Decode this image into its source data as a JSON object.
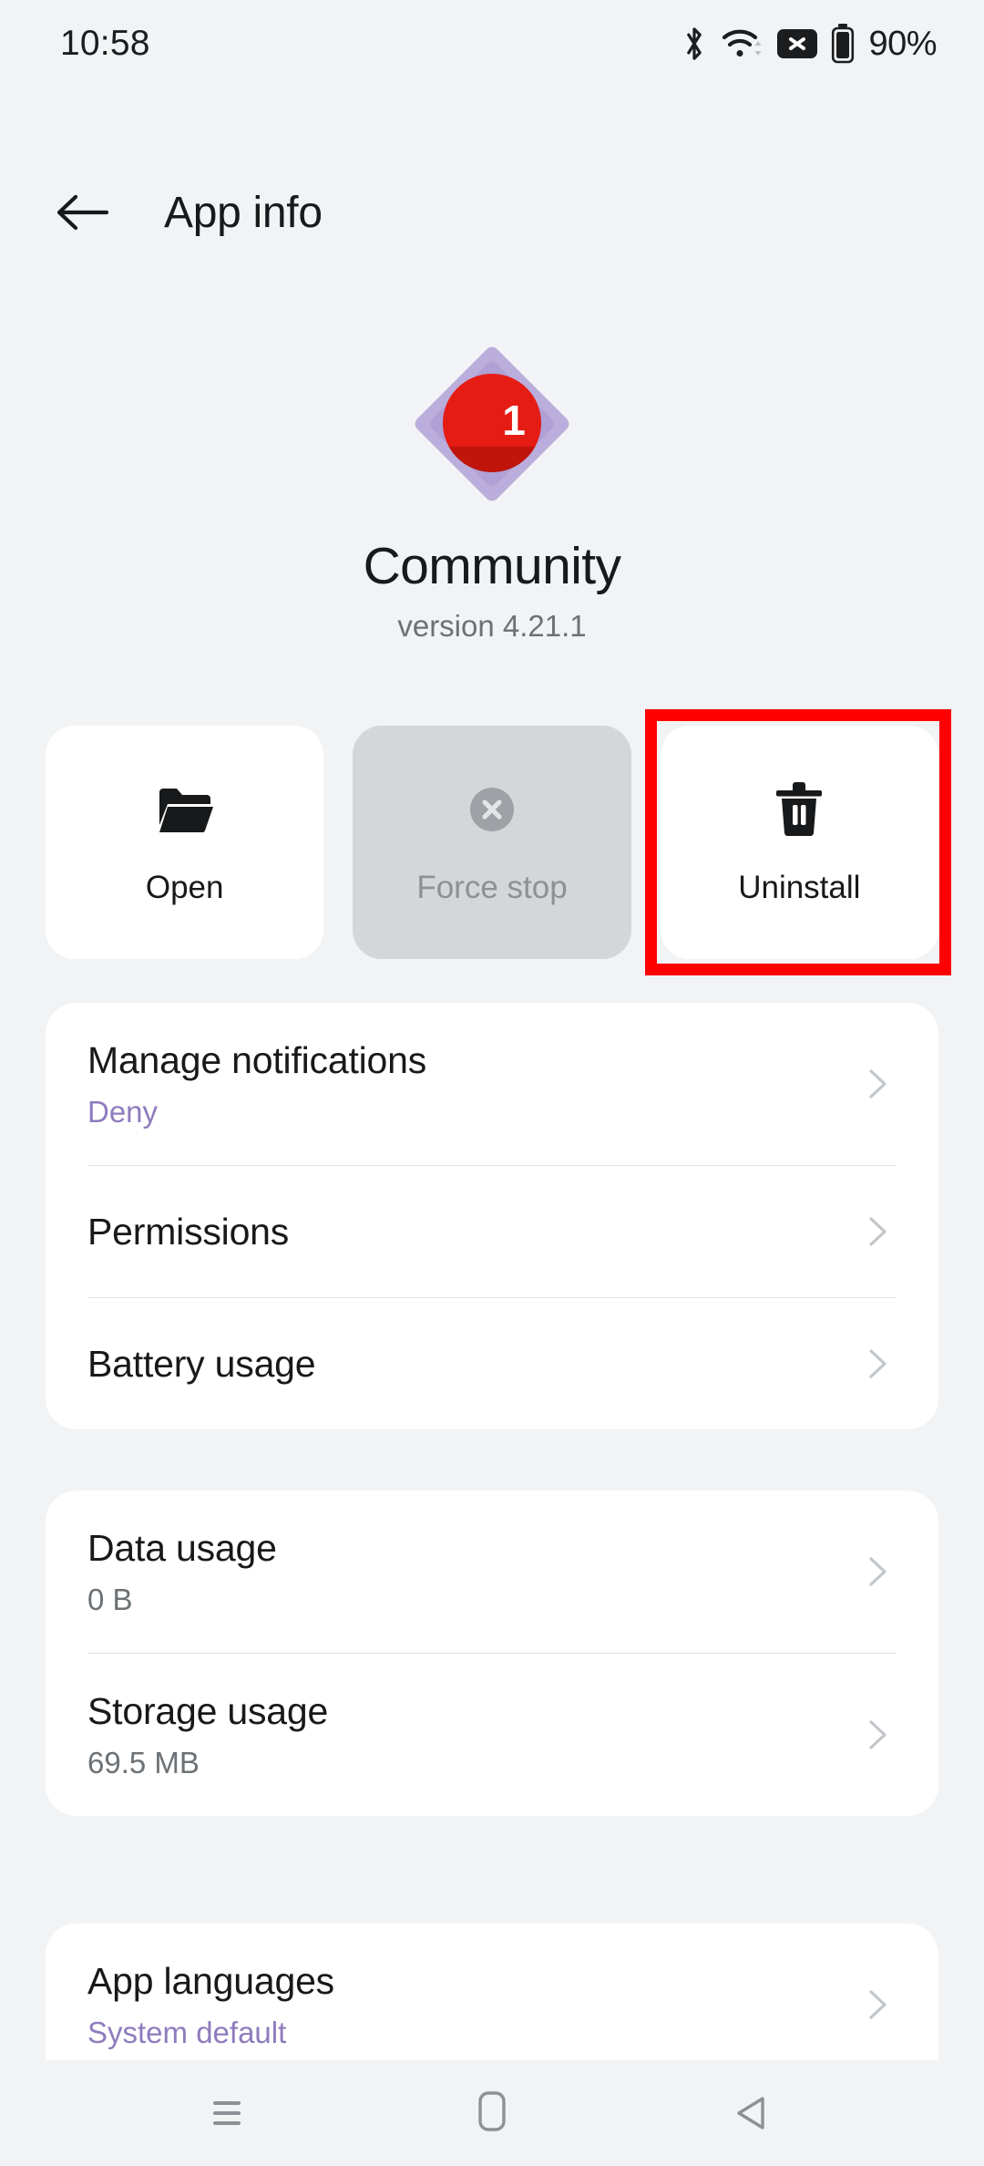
{
  "status_bar": {
    "time": "10:58",
    "battery_percent": "90%",
    "icons": [
      "bluetooth-icon",
      "wifi-icon",
      "no-sim-icon",
      "battery-icon"
    ]
  },
  "app_bar": {
    "back_icon": "back-arrow-icon",
    "title": "App info"
  },
  "app_identity": {
    "icon": "community-app-icon",
    "icon_badge": "1",
    "name": "Community",
    "version": "version 4.21.1"
  },
  "actions": [
    {
      "label": "Open",
      "icon": "folder-open-icon",
      "disabled": false,
      "highlighted": false
    },
    {
      "label": "Force stop",
      "icon": "x-circle-icon",
      "disabled": true,
      "highlighted": false
    },
    {
      "label": "Uninstall",
      "icon": "trash-icon",
      "disabled": false,
      "highlighted": true
    }
  ],
  "highlight_color": "#FF0000",
  "accent_purple": "#8E7CBD",
  "cards": [
    {
      "rows": [
        {
          "title": "Manage notifications",
          "sub": "Deny",
          "sub_style": "purple"
        },
        {
          "title": "Permissions",
          "sub": "",
          "sub_style": ""
        },
        {
          "title": "Battery usage",
          "sub": "",
          "sub_style": ""
        }
      ]
    },
    {
      "rows": [
        {
          "title": "Data usage",
          "sub": "0 B",
          "sub_style": "grey"
        },
        {
          "title": "Storage usage",
          "sub": "69.5 MB",
          "sub_style": "grey"
        }
      ]
    },
    {
      "rows": [
        {
          "title": "App languages",
          "sub": "System default",
          "sub_style": "purple"
        }
      ]
    }
  ],
  "nav_bar": {
    "recents": "recents-icon",
    "home": "home-icon",
    "back": "back-icon"
  }
}
